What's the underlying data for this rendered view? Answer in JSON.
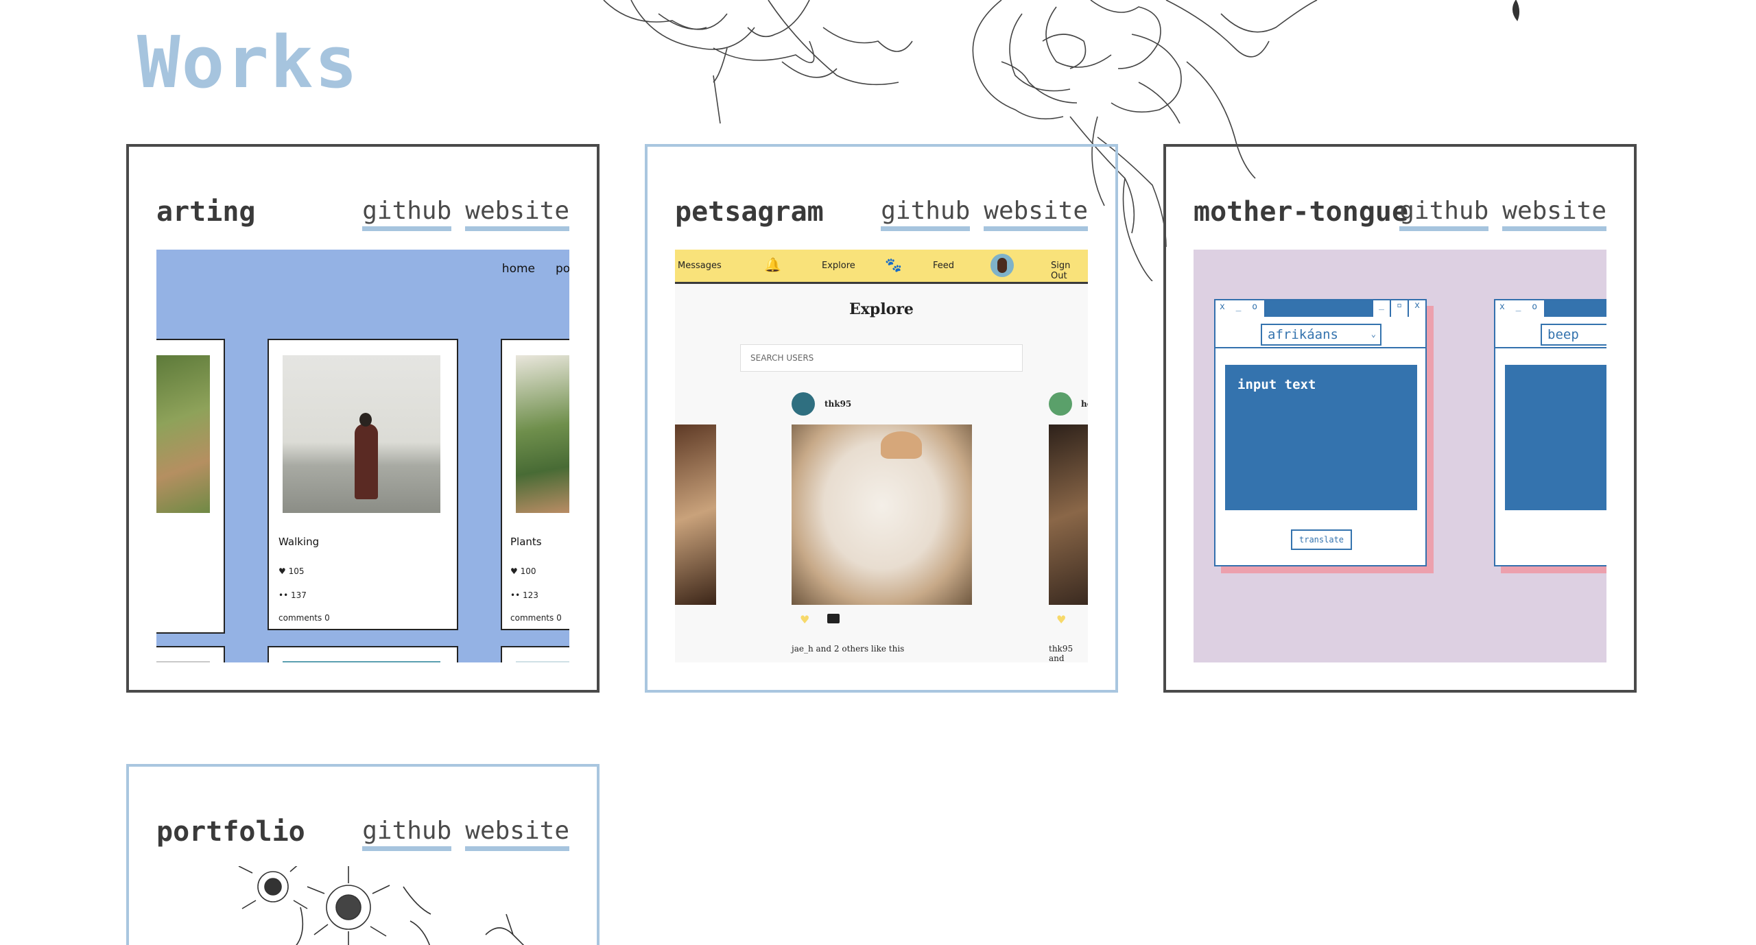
{
  "page": {
    "title": "Works"
  },
  "projects": [
    {
      "title": "arting",
      "github_label": "github",
      "website_label": "website"
    },
    {
      "title": "petsagram",
      "github_label": "github",
      "website_label": "website"
    },
    {
      "title": "mother-tongue",
      "github_label": "github",
      "website_label": "website"
    },
    {
      "title": "portfolio",
      "github_label": "github",
      "website_label": "website"
    }
  ],
  "arting_preview": {
    "nav": [
      "home",
      "po"
    ],
    "cards": [
      {
        "name": "Walking",
        "likes": "105",
        "views": "137",
        "comments": "comments 0"
      },
      {
        "name": "Plants",
        "likes": "100",
        "views": "123",
        "comments": "comments 0"
      }
    ],
    "colors": {
      "background": "#94b2e4"
    }
  },
  "petsagram_preview": {
    "nav": [
      "Messages",
      "Explore",
      "Feed",
      "Sign Out"
    ],
    "heading": "Explore",
    "search_placeholder": "SEARCH USERS",
    "posts": [
      {
        "user": "thk95",
        "likes_text": "jae_h and 2 others like this"
      },
      {
        "user": "he",
        "likes_text": "thk95 and"
      }
    ],
    "colors": {
      "nav": "#f9e27a"
    }
  },
  "mother_tongue_preview": {
    "windows": [
      {
        "language": "afrikáans",
        "input_text": "input text",
        "button": "translate"
      },
      {
        "language": "beep"
      }
    ],
    "window_controls": "x _ o",
    "colors": {
      "background": "#ddd0e2",
      "window": "#3473ae",
      "shadow": "#eca0ad"
    }
  }
}
